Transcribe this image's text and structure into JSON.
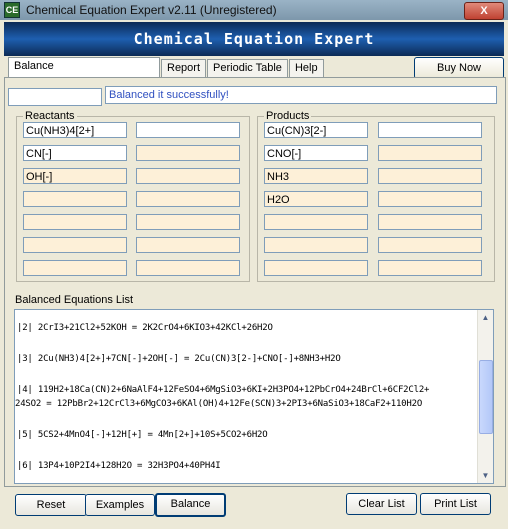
{
  "window": {
    "title": "Chemical Equation Expert v2.11 (Unregistered)",
    "close_label": "X",
    "icon_label": "CE"
  },
  "banner": {
    "title": "Chemical Equation Expert"
  },
  "tabs": [
    {
      "label": "Balance"
    },
    {
      "label": "Report"
    },
    {
      "label": "Periodic Table"
    },
    {
      "label": "Help"
    }
  ],
  "buy_button": {
    "label": "Buy Now"
  },
  "status": {
    "message": "Balanced it successfully!"
  },
  "reactants": {
    "legend": "Reactants",
    "rows": [
      [
        "Cu(NH3)4[2+]",
        ""
      ],
      [
        "CN[-]",
        ""
      ],
      [
        "OH[-]",
        ""
      ],
      [
        "",
        ""
      ],
      [
        "",
        ""
      ],
      [
        "",
        ""
      ],
      [
        "",
        ""
      ]
    ]
  },
  "products": {
    "legend": "Products",
    "rows": [
      [
        "Cu(CN)3[2-]",
        ""
      ],
      [
        "CNO[-]",
        ""
      ],
      [
        "NH3",
        ""
      ],
      [
        "H2O",
        ""
      ],
      [
        "",
        ""
      ],
      [
        "",
        ""
      ],
      [
        "",
        ""
      ]
    ]
  },
  "equations": {
    "label": "Balanced Equations List",
    "lines": [
      "|2| 2CrI3+21Cl2+52KOH = 2K2CrO4+6KIO3+42KCl+26H2O",
      "|3| 2Cu(NH3)4[2+]+7CN[-]+2OH[-] = 2Cu(CN)3[2-]+CNO[-]+8NH3+H2O",
      "|4| 119H2+18Ca(CN)2+6NaAlF4+12FeSO4+6MgSiO3+6KI+2H3PO4+12PbCrO4+24BrCl+6CF2Cl2+",
      "24SO2 = 12PbBr2+12CrCl3+6MgCO3+6KAl(OH)4+12Fe(SCN)3+2PI3+6NaSiO3+18CaF2+110H2O",
      "|5| 5CS2+4MnO4[-]+12H[+] = 4Mn[2+]+10S+5CO2+6H2O",
      "|6| 13P4+10P2I4+128H2O = 32H3PO4+40PH4I"
    ]
  },
  "scroll": {
    "up": "▲",
    "down": "▼"
  },
  "buttons": {
    "reset": "Reset",
    "examples": "Examples",
    "balance": "Balance",
    "clear_list": "Clear List",
    "print_list": "Print List"
  }
}
